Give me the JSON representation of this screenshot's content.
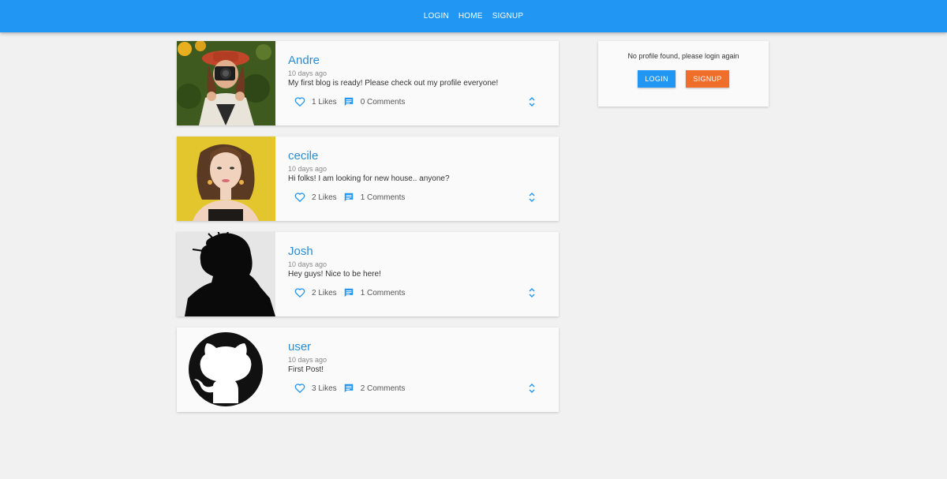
{
  "nav": {
    "login": "LOGIN",
    "home": "HOME",
    "signup": "SIGNUP"
  },
  "posts": [
    {
      "author": "Andre",
      "time": "10 days ago",
      "message": "My first blog is ready! Please check out my profile everyone!",
      "likes": "1 Likes",
      "comments": "0 Comments",
      "avatar": "photo-camera-girl"
    },
    {
      "author": "cecile",
      "time": "10 days ago",
      "message": "Hi folks! I am looking for new house.. anyone?",
      "likes": "2 Likes",
      "comments": "1 Comments",
      "avatar": "photo-woman-yellow"
    },
    {
      "author": "Josh",
      "time": "10 days ago",
      "message": "Hey guys! Nice to be here!",
      "likes": "2 Likes",
      "comments": "1 Comments",
      "avatar": "photo-silhouette"
    },
    {
      "author": "user",
      "time": "10 days ago",
      "message": "First Post!",
      "likes": "3 Likes",
      "comments": "2 Comments",
      "avatar": "github-icon"
    }
  ],
  "profile": {
    "notice": "No profile found, please login again",
    "login_label": "LOGIN",
    "signup_label": "SIGNUP"
  },
  "colors": {
    "primary": "#2196f3",
    "accent": "#ee6e2a",
    "author": "#2e8ccf"
  }
}
